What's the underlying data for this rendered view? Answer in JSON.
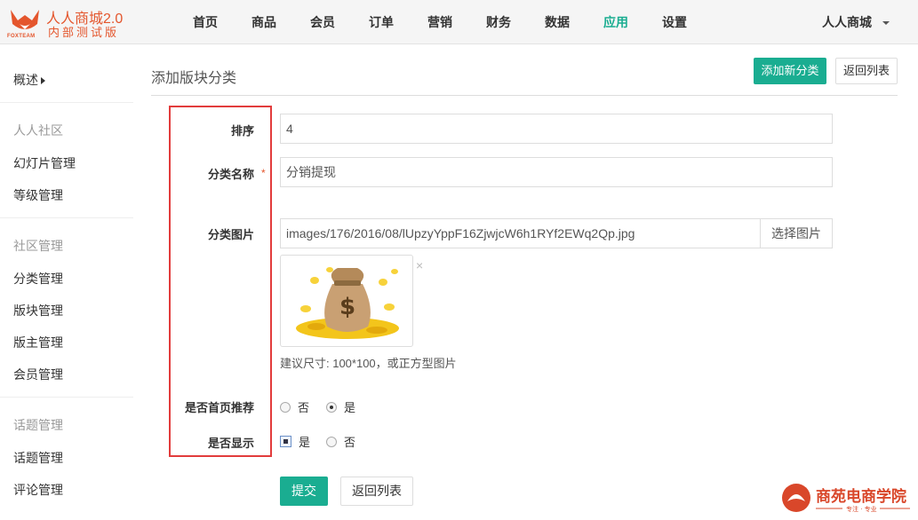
{
  "brand": {
    "title": "人人商城2.0",
    "subtitle": "内部测试版",
    "logo_text": "FOXTEAM",
    "color": "#e4562d"
  },
  "nav": {
    "items": [
      {
        "label": "首页"
      },
      {
        "label": "商品"
      },
      {
        "label": "会员"
      },
      {
        "label": "订单"
      },
      {
        "label": "营销"
      },
      {
        "label": "财务"
      },
      {
        "label": "数据"
      },
      {
        "label": "应用",
        "active": true
      },
      {
        "label": "设置"
      }
    ],
    "user": "人人商城",
    "accent": "#1aad91"
  },
  "sidebar": {
    "overview": "概述",
    "sections": [
      {
        "title": "人人社区",
        "items": [
          "幻灯片管理",
          "等级管理"
        ]
      },
      {
        "title": "社区管理",
        "items": [
          "分类管理",
          "版块管理",
          "版主管理",
          "会员管理"
        ]
      },
      {
        "title": "话题管理",
        "items": [
          "话题管理",
          "评论管理"
        ]
      }
    ]
  },
  "page": {
    "title": "添加版块分类",
    "add_button": "添加新分类",
    "back_button": "返回列表"
  },
  "form": {
    "sort_label": "排序",
    "sort_value": "4",
    "name_label": "分类名称",
    "required_mark": "*",
    "name_value": "分销提现",
    "image_label": "分类图片",
    "image_value": "images/176/2016/08/lUpzyYppF16ZjwjcW6h1RYf2EWq2Qp.jpg",
    "image_button": "选择图片",
    "image_remove": "×",
    "image_hint": "建议尺寸: 100*100，或正方型图片",
    "recommend_label": "是否首页推荐",
    "recommend_options": [
      "否",
      "是"
    ],
    "recommend_selected": "是",
    "show_label": "是否显示",
    "show_options": [
      "是",
      "否"
    ],
    "show_selected": "是",
    "submit_button": "提交",
    "back_button": "返回列表"
  },
  "watermark": {
    "text": "商苑电商学院",
    "tagline": "专注 · 专业"
  }
}
